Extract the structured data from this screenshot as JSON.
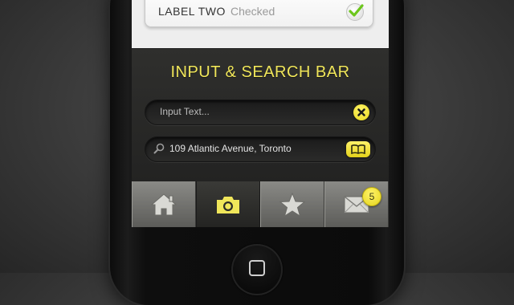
{
  "list_card": {
    "label": "LABEL TWO",
    "value": "Checked",
    "icon": "checkmark-icon"
  },
  "search_section": {
    "title": "INPUT & SEARCH BAR",
    "text_field": {
      "placeholder": "Input Text...",
      "value": "",
      "clear_icon": "clear-x-icon"
    },
    "search_field": {
      "value": "109 Atlantic Avenue, Toronto",
      "search_icon": "magnifier-icon",
      "action_icon": "address-book-icon"
    }
  },
  "tab_bar": {
    "tabs": [
      {
        "icon": "home-icon",
        "active": false
      },
      {
        "icon": "camera-icon",
        "active": true
      },
      {
        "icon": "star-icon",
        "active": false
      },
      {
        "icon": "mail-icon",
        "active": false,
        "badge": "5"
      }
    ]
  },
  "colors": {
    "accent_yellow": "#f0e65a",
    "dark_panel": "#2a2a28",
    "tab_gray": "#7a7a76"
  }
}
